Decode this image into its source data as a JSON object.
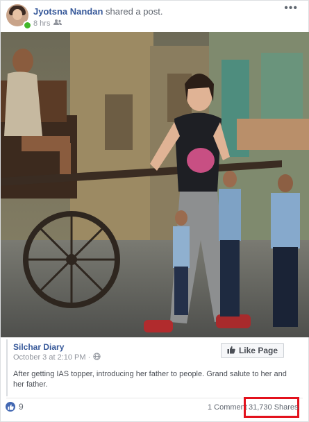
{
  "post": {
    "author": "Jyotsna Nandan",
    "action": "shared a post.",
    "time": "8 hrs",
    "audience_icon": "friends-icon",
    "more_icon": "more-dots-icon",
    "more_glyph": "•••"
  },
  "shared": {
    "page_name": "Silchar Diary",
    "date": "October 3 at 2:10 PM ·",
    "audience_icon": "globe-icon",
    "text": "After getting IAS topper, introducing her father to people. Grand salute to her and her father.",
    "like_page_label": "Like Page"
  },
  "footer": {
    "like_count": "9",
    "comments": "1 Comment",
    "shares": "31,730 Shares"
  },
  "colors": {
    "link": "#365899",
    "highlight": "#e3111c",
    "like_blue": "#4267b2"
  }
}
